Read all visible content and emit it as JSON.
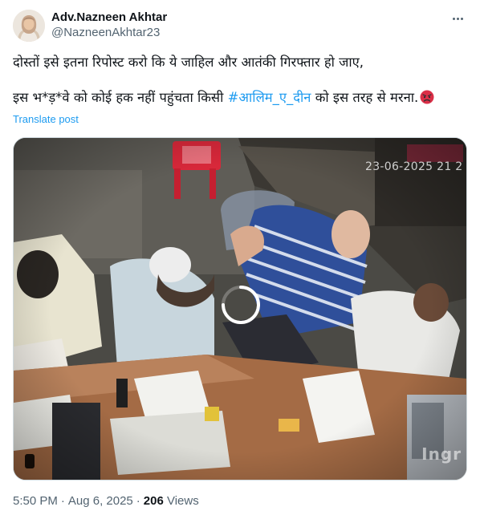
{
  "author": {
    "display_name": "Adv.Nazneen Akhtar",
    "handle": "@NazneenAkhtar23"
  },
  "post": {
    "line1": "दोस्तों इसे इतना रिपोस्ट करो कि ये जाहिल और आतंकी गिरफ्तार हो जाए,",
    "line2_before": "इस भ*ड़*वे को कोई हक नहीं पहुंचता किसी ",
    "hashtag": "#आलिम_ए_दीन",
    "line2_after": " को इस तरह से मरना.",
    "emoji": "angry-face-emoji"
  },
  "translate_label": "Translate post",
  "video": {
    "timestamp_overlay": "23-06-2025 21 2",
    "watermark": "Ingr"
  },
  "meta": {
    "time": "5:50 PM",
    "date": "Aug 6, 2025",
    "views_count": "206",
    "views_label": "Views"
  },
  "colors": {
    "accent": "#1d9bf0",
    "text_primary": "#0f1419",
    "text_secondary": "#536471",
    "border": "#cfd9de"
  }
}
